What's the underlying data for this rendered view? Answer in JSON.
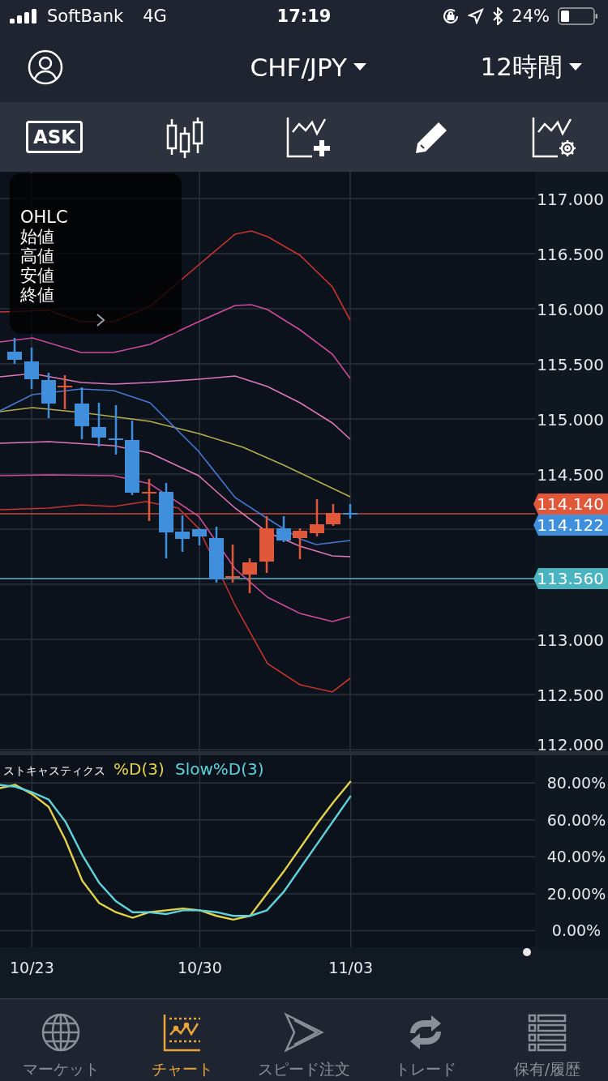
{
  "status_bar": {
    "carrier": "SoftBank",
    "network": "4G",
    "time": "17:19",
    "battery": "24%"
  },
  "header": {
    "pair": "CHF/JPY",
    "timeframe": "12時間"
  },
  "toolbar": {
    "ask_label": "ASK"
  },
  "price_chart": {
    "ohlc_panel": [
      "OHLC",
      "始値",
      "高値",
      "安値",
      "終値"
    ],
    "price_axis": [
      "117.000",
      "116.500",
      "116.000",
      "115.500",
      "115.000",
      "114.500",
      "113.000",
      "112.500",
      "112.000"
    ],
    "price_tags": [
      {
        "text": "114.140",
        "color": "#e0573a"
      },
      {
        "text": "114.122",
        "color": "#3f8fdc"
      },
      {
        "text": "113.560",
        "color": "#49b3c0"
      }
    ]
  },
  "stochastic": {
    "chart_data": {
      "type": "line",
      "title": "ストキャスティクス",
      "grid": true,
      "ylim": [
        -0.09,
        0.95
      ],
      "yticks": [
        {
          "value": 0,
          "label": "0.00%"
        },
        {
          "value": 0.2,
          "label": "20.00%"
        },
        {
          "value": 0.4,
          "label": "40.00%"
        },
        {
          "value": 0.6,
          "label": "60.00%"
        },
        {
          "value": 0.8,
          "label": "80.00%"
        }
      ],
      "series": [
        {
          "name": "%D(3)",
          "color": "#e3d24a",
          "values": [
            0.77,
            0.79,
            0.74,
            0.67,
            0.49,
            0.27,
            0.15,
            0.1,
            0.07,
            0.1,
            0.11,
            0.12,
            0.11,
            0.08,
            0.06,
            0.08,
            0.2,
            0.32,
            0.45,
            0.58,
            0.7,
            0.81
          ]
        },
        {
          "name": "Slow%D(3)",
          "color": "#5fd3dc",
          "values": [
            0.79,
            0.78,
            0.75,
            0.71,
            0.59,
            0.41,
            0.26,
            0.16,
            0.1,
            0.1,
            0.09,
            0.11,
            0.11,
            0.1,
            0.08,
            0.08,
            0.11,
            0.21,
            0.34,
            0.47,
            0.6,
            0.73
          ]
        }
      ]
    },
    "date_axis": [
      "10/23",
      "10/30",
      "11/03"
    ]
  },
  "tab_bar": [
    {
      "label": "マーケット",
      "selected": false
    },
    {
      "label": "チャート",
      "selected": true
    },
    {
      "label": "スピード注文",
      "selected": false
    },
    {
      "label": "トレード",
      "selected": false
    },
    {
      "label": "保有/履歴",
      "selected": false
    }
  ]
}
